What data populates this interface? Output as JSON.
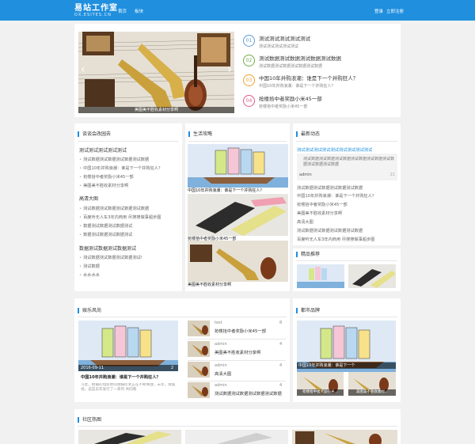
{
  "header": {
    "logo_main": "易站工作室",
    "logo_sub": "DX.ESITES.CN",
    "nav": [
      "首页",
      "板块"
    ],
    "login": "登录",
    "register": "立即注册"
  },
  "carousel": {
    "caption": "美图美不胜收素材分享啊",
    "prev": "‹",
    "next": "›"
  },
  "top_list": [
    {
      "num": "01",
      "title": "测试测试测试测试测试",
      "sub": "测试测试测试测试测试",
      "color": "#5b9bd5"
    },
    {
      "num": "02",
      "title": "测试数据测试数据测试数据测试数据",
      "sub": "测试数据测试数据测试数据测试数据",
      "color": "#70ad47"
    },
    {
      "num": "03",
      "title": "中国10年并购浪潮：谁是下一个并购狂人？",
      "sub": "中国10年并购浪潮：谁是下一个并购狂人？",
      "color": "#f0a030"
    },
    {
      "num": "04",
      "title": "抢楼拾中者奖励小米45一部",
      "sub": "抢楼拾中者奖励小米45一部",
      "color": "#e05a8a"
    }
  ],
  "col1": {
    "title": "谈谈会改园去",
    "g1": {
      "head": "测试测试测试测试测试",
      "items": [
        "测试数据测试数据测试数据测试数据",
        "中国10年并购浪潮：谁是下一个并购狂人？",
        "抢楼拾中者奖励小米45一部",
        "美图美不胜收素材分享啊"
      ]
    },
    "g2": {
      "head": "高清大图",
      "items": [
        "测试数据测试数据测试数据测试数据",
        "百度听无人车3年内商用 尽搜搜做事超步图",
        "数据测试数据测试数据测试",
        "数据测试数据测试数据测试"
      ]
    },
    "g3": {
      "head": "数据测试数据测试数据测试",
      "items": [
        "测试数据测试数据测试数据测试!",
        "测试数据",
        "水水水水"
      ]
    }
  },
  "col2": {
    "title": "生活攻略",
    "cap1": "中国10年并购浪潮：谁是下一个并购狂人？",
    "cap2": "抢楼拾中者奖励小米45一部",
    "cap3": "美图美不胜收素材分享啊"
  },
  "col3": {
    "title": "最新动态",
    "link": "测试测试测试测试测试测试测试测试测试",
    "quote": "测试数据测试数据测试数据测试数据测试数据测试数据测试数据测试数据",
    "author": "admin",
    "count": "21",
    "items": [
      "测试数据测试数据测试数据测试数据",
      "中国10年并购浪潮：谁是下一个并购狂人？",
      "抢楼拾中者奖励小米45一部",
      "美图美不胜收素材分享啊",
      "高清大图",
      "测试数据测试数据测试数据测试数据",
      "百度听无人车3年内商用 尽搜搜做事超步图"
    ],
    "rec_title": "精品推荐"
  },
  "ent": {
    "title": "娱乐风尚",
    "date": "2016-09-11",
    "comments": "2",
    "headline": "中国10年并购浪潮：谁是下一个并购狂人？",
    "desc": "习此，拍摄的电影依的拍摄阶式正在不断释放。去年，搜狐视，说是去年发行了一系列 共同看",
    "rows": [
      {
        "author": "test",
        "count": "8",
        "title": "抢楼拾中者奖励小米45一部"
      },
      {
        "author": "admin",
        "count": "4",
        "title": "美图美不胜收素材分享啊"
      },
      {
        "author": "admin",
        "count": "4",
        "title": "高清大图"
      },
      {
        "author": "admin",
        "count": "4",
        "title": "测试数据测试数据测试数据测试数据"
      }
    ]
  },
  "brand": {
    "title": "都市品牌",
    "cap1": "中国10年并购浪潮：谁是下一个",
    "cap2": "抢楼拾中者奖励小米...",
    "cap3": "美图美不胜收素材..."
  },
  "community": {
    "title": "社区热图"
  }
}
